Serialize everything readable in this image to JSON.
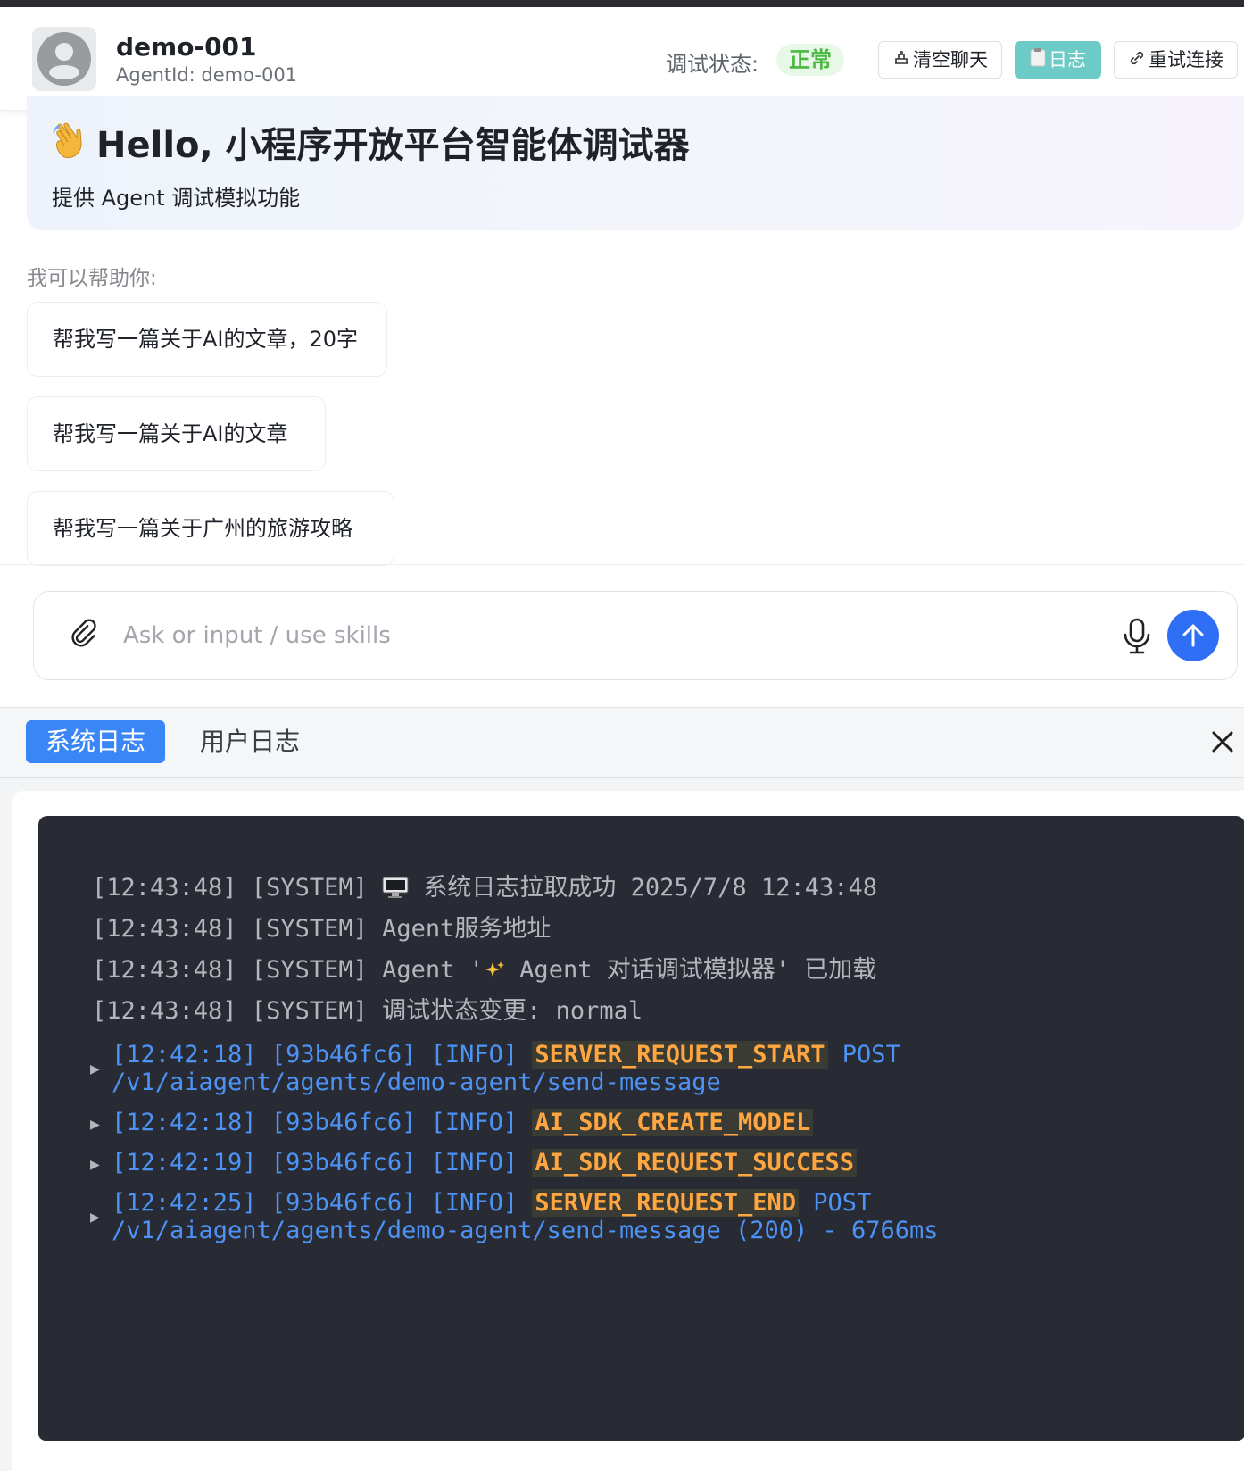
{
  "header": {
    "agent_name": "demo-001",
    "agent_id": "AgentId: demo-001",
    "status_label": "调试状态:",
    "status_value": "正常",
    "btn_clear": "清空聊天",
    "btn_log": "日志",
    "btn_retry": "重试连接"
  },
  "welcome": {
    "title": "Hello, 小程序开放平台智能体调试器",
    "subtitle": "提供 Agent 调试模拟功能"
  },
  "help": {
    "label": "我可以帮助你:",
    "suggestions": [
      "帮我写一篇关于AI的文章，20字",
      "帮我写一篇关于AI的文章",
      "帮我写一篇关于广州的旅游攻略"
    ]
  },
  "input": {
    "placeholder": "Ask or input / use skills",
    "value": ""
  },
  "logs": {
    "tabs": [
      "系统日志",
      "用户日志"
    ],
    "active_tab": "系统日志",
    "system_lines": [
      {
        "prefix": "[12:43:48] [SYSTEM]",
        "text": "系统日志拉取成功 2025/7/8 12:43:48",
        "emoji": "desktop-icon"
      },
      {
        "prefix": "[12:43:48] [SYSTEM]",
        "text": "Agent服务地址"
      },
      {
        "prefix": "[12:43:48] [SYSTEM]",
        "text_a": "Agent '",
        "text_b": " Agent 对话调试模拟器' 已加载",
        "emoji": "sparkles-icon"
      },
      {
        "prefix": "[12:43:48] [SYSTEM]",
        "text": "调试状态变更: normal"
      }
    ],
    "info_entries": [
      {
        "prefix": "[12:42:18] [93b46fc6] [INFO]",
        "event": "SERVER_REQUEST_START",
        "method": "POST",
        "detail": "/v1/aiagent/agents/demo-agent/send-message"
      },
      {
        "prefix": "[12:42:18] [93b46fc6] [INFO]",
        "event": "AI_SDK_CREATE_MODEL"
      },
      {
        "prefix": "[12:42:19] [93b46fc6] [INFO]",
        "event": "AI_SDK_REQUEST_SUCCESS"
      },
      {
        "prefix": "[12:42:25] [93b46fc6] [INFO]",
        "event": "SERVER_REQUEST_END",
        "method": "POST",
        "detail": "/v1/aiagent/agents/demo-agent/send-message (200) - 6766ms"
      }
    ]
  },
  "colors": {
    "accent_blue": "#2f6ff5",
    "tab_active": "#3a86f6",
    "log_button": "#6ccbc6",
    "status_green": "#4bb841",
    "terminal_bg": "#282b33",
    "log_info": "#4d92f5",
    "log_event": "#ffa640"
  }
}
